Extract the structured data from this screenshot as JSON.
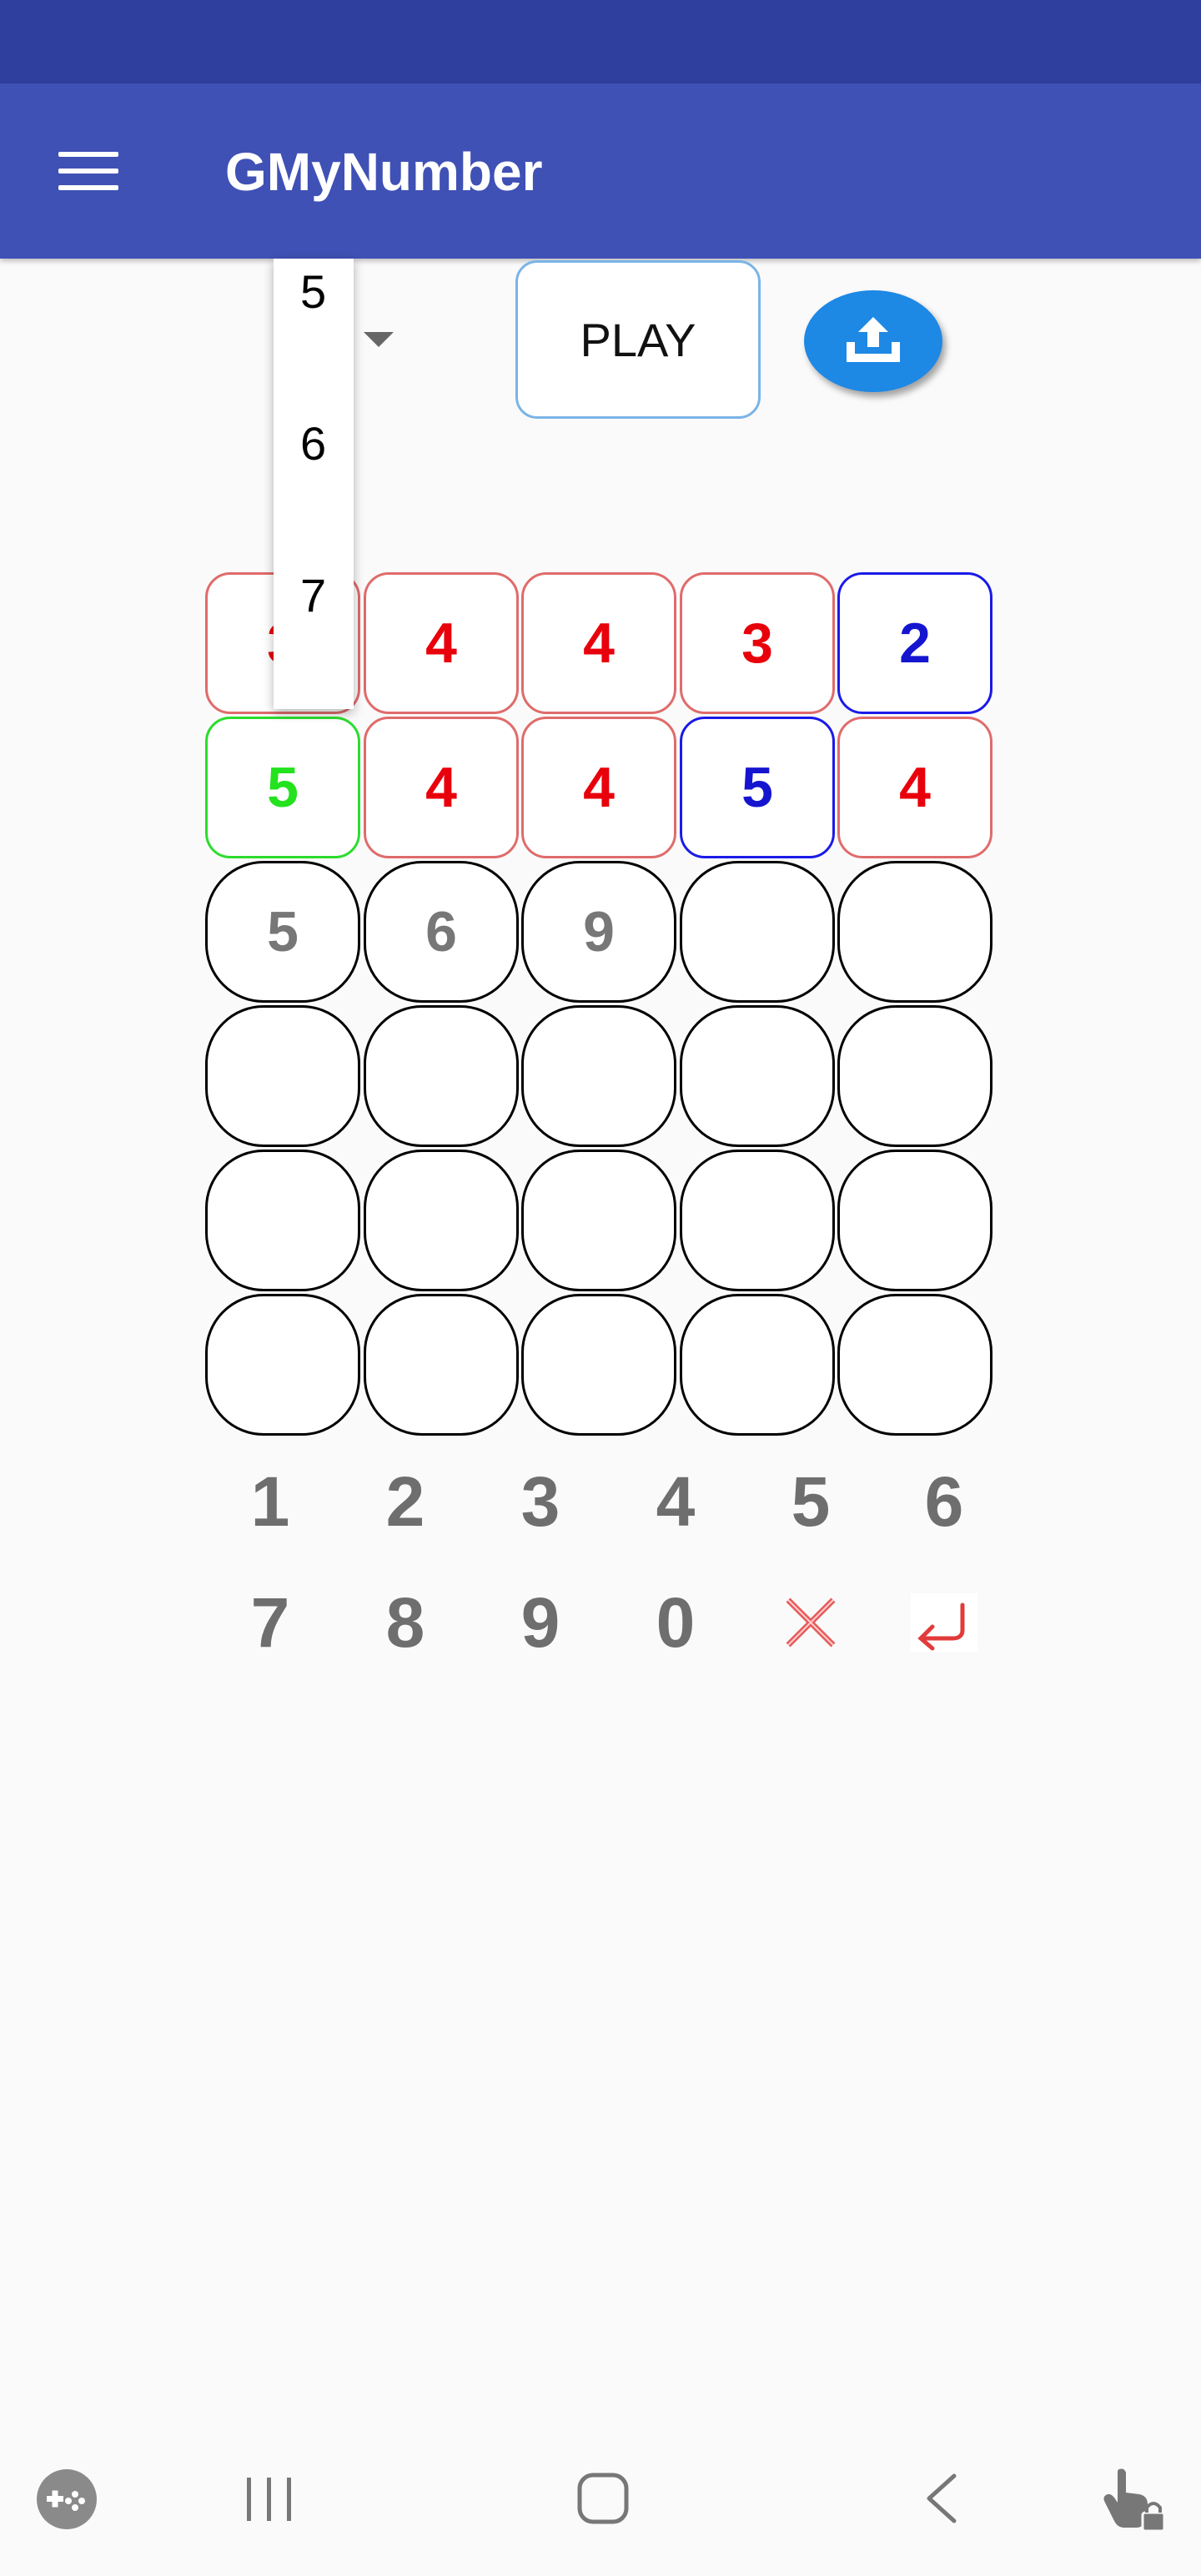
{
  "app_bar": {
    "title": "GMyNumber"
  },
  "dropdown": {
    "options": [
      "5",
      "6",
      "7"
    ]
  },
  "toolbar": {
    "play_label": "PLAY"
  },
  "guess_rows": [
    [
      {
        "value": "3",
        "state": "red"
      },
      {
        "value": "4",
        "state": "red"
      },
      {
        "value": "4",
        "state": "red"
      },
      {
        "value": "3",
        "state": "red"
      },
      {
        "value": "2",
        "state": "blue"
      }
    ],
    [
      {
        "value": "5",
        "state": "green"
      },
      {
        "value": "4",
        "state": "red"
      },
      {
        "value": "4",
        "state": "red"
      },
      {
        "value": "5",
        "state": "blue"
      },
      {
        "value": "4",
        "state": "red"
      }
    ],
    [
      {
        "value": "5",
        "state": "input"
      },
      {
        "value": "6",
        "state": "input"
      },
      {
        "value": "9",
        "state": "input"
      },
      {
        "value": "",
        "state": "input"
      },
      {
        "value": "",
        "state": "input"
      }
    ],
    [
      {
        "value": "",
        "state": "input"
      },
      {
        "value": "",
        "state": "input"
      },
      {
        "value": "",
        "state": "input"
      },
      {
        "value": "",
        "state": "input"
      },
      {
        "value": "",
        "state": "input"
      }
    ],
    [
      {
        "value": "",
        "state": "input"
      },
      {
        "value": "",
        "state": "input"
      },
      {
        "value": "",
        "state": "input"
      },
      {
        "value": "",
        "state": "input"
      },
      {
        "value": "",
        "state": "input"
      }
    ],
    [
      {
        "value": "",
        "state": "input"
      },
      {
        "value": "",
        "state": "input"
      },
      {
        "value": "",
        "state": "input"
      },
      {
        "value": "",
        "state": "input"
      },
      {
        "value": "",
        "state": "input"
      }
    ]
  ],
  "keypad": {
    "row1": [
      "1",
      "2",
      "3",
      "4",
      "5",
      "6"
    ],
    "row2": [
      "7",
      "8",
      "9",
      "0"
    ],
    "delete_icon": "x-icon",
    "enter_icon": "enter-arrow-icon"
  },
  "nav_bar": {
    "icons": [
      "game-launcher-icon",
      "recent-apps-icon",
      "home-icon",
      "back-icon",
      "touch-lock-icon"
    ]
  },
  "colors": {
    "status_bar": "#2f3f9e",
    "app_bar": "#3f51b5",
    "red": "#e8000b",
    "blue": "#1515d0",
    "green": "#23e21e",
    "share_button": "#1e88e5"
  }
}
